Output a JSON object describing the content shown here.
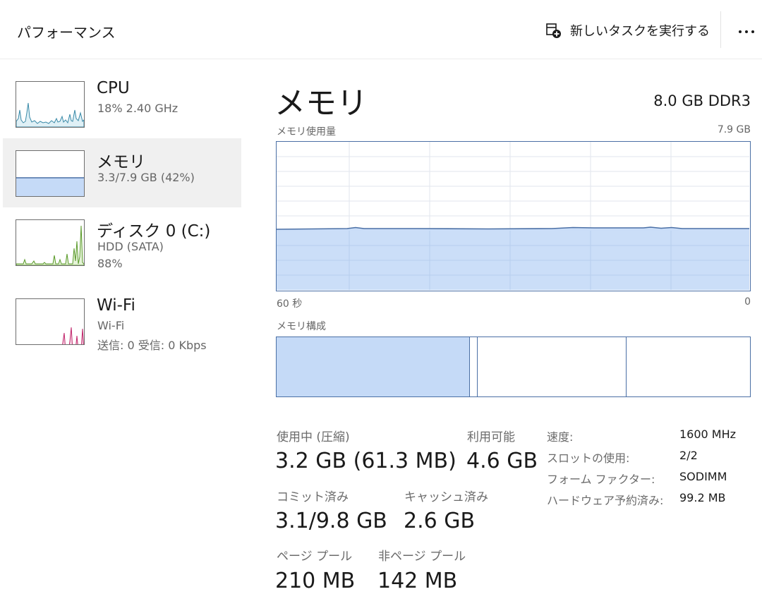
{
  "header": {
    "title": "パフォーマンス",
    "run_task_label": "新しいタスクを実行する",
    "run_task_icon": "new-task-icon",
    "more_icon": "more-horizontal-icon"
  },
  "resources": [
    {
      "name": "CPU",
      "sub1": "18%  2.40 GHz",
      "sub2": "",
      "color": "#3a8aa8",
      "fill": "#dff0f6"
    },
    {
      "name": "メモリ",
      "sub1": "3.3/7.9 GB (42%)",
      "sub2": "",
      "color": "#4a6fa5",
      "fill": "#c5daf7"
    },
    {
      "name": "ディスク 0 (C:)",
      "sub1": "HDD (SATA)",
      "sub2": "88%",
      "color": "#5a9a2a",
      "fill": "#e5f3d8"
    },
    {
      "name": "Wi-Fi",
      "sub1": "Wi-Fi",
      "sub2": "送信: 0 受信: 0 Kbps",
      "color": "#c0246a",
      "fill": "#f7d8e6"
    }
  ],
  "main": {
    "title": "メモリ",
    "spec": "8.0 GB DDR3",
    "usage_label": "メモリ使用量",
    "usage_max": "7.9 GB",
    "time_left": "60 秒",
    "time_right": "0",
    "composition_label": "メモリ構成",
    "usage_fraction": 0.415,
    "composition": {
      "in_use": 0.41,
      "modified": 0.016,
      "standby": 0.33,
      "free": 0.244
    }
  },
  "stats": {
    "in_use_label": "使用中 (圧縮)",
    "in_use_value": "3.2 GB (61.3 MB)",
    "available_label": "利用可能",
    "available_value": "4.6 GB",
    "committed_label": "コミット済み",
    "committed_value": "3.1/9.8 GB",
    "cached_label": "キャッシュ済み",
    "cached_value": "2.6 GB",
    "paged_label": "ページ プール",
    "paged_value": "210 MB",
    "nonpaged_label": "非ページ プール",
    "nonpaged_value": "142 MB"
  },
  "properties": [
    {
      "key": "速度:",
      "value": "1600 MHz"
    },
    {
      "key": "スロットの使用:",
      "value": "2/2"
    },
    {
      "key": "フォーム ファクター:",
      "value": "SODIMM"
    },
    {
      "key": "ハードウェア予約済み:",
      "value": "99.2 MB"
    }
  ],
  "colors": {
    "memory_line": "#4a6fa5",
    "memory_fill": "#c5daf7",
    "grid": "#e2e6ee"
  }
}
